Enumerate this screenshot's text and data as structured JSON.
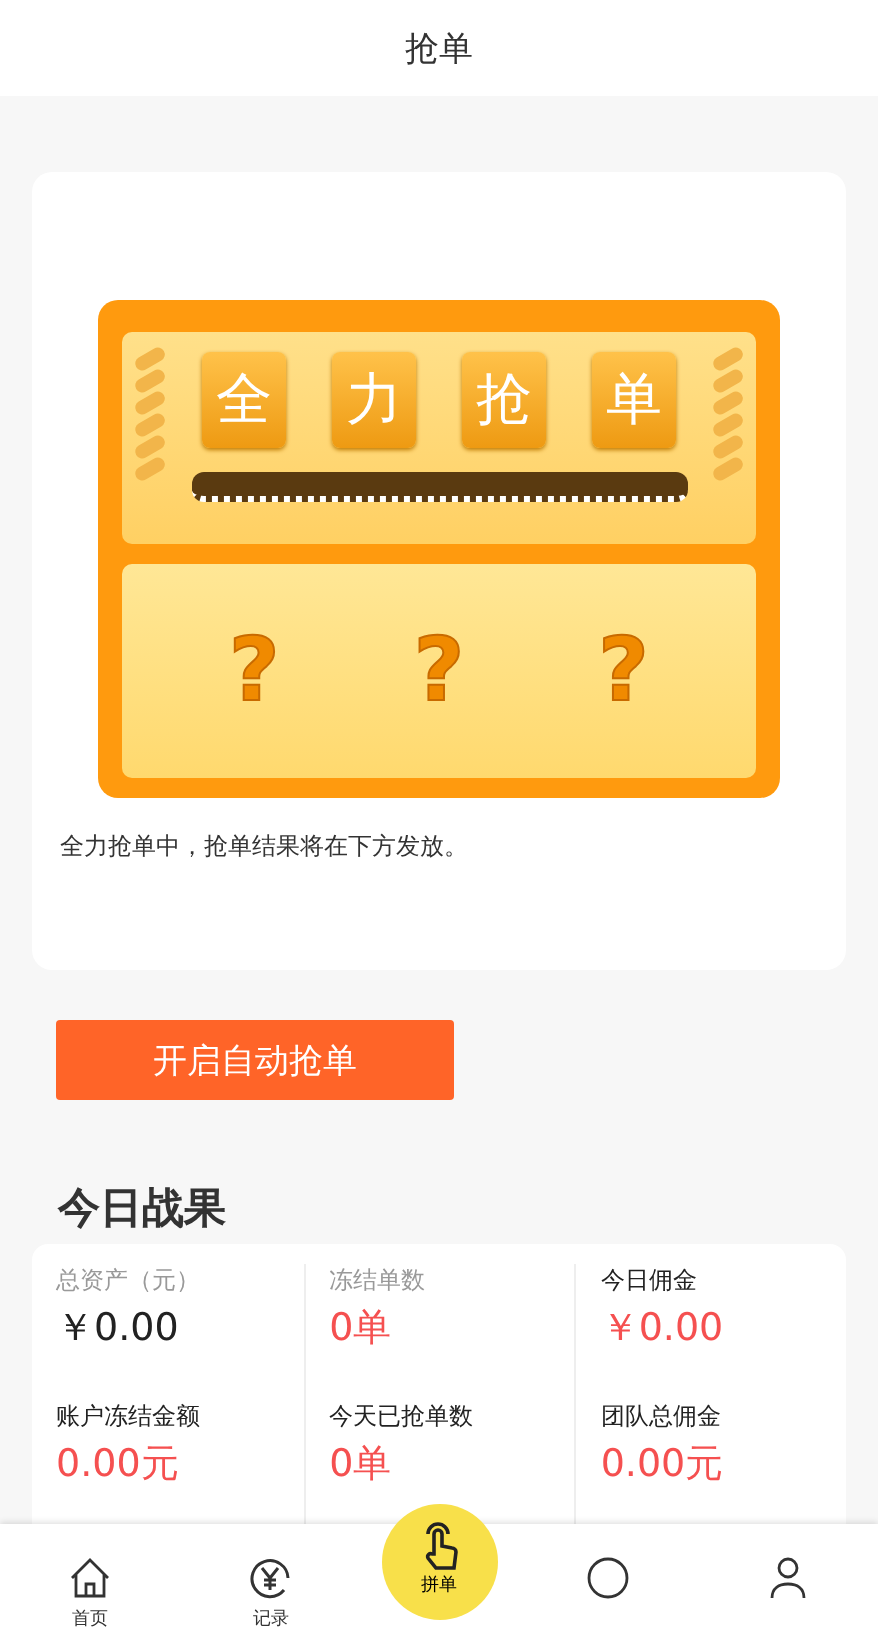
{
  "header": {
    "title": "抢单"
  },
  "machine": {
    "tiles": [
      "全",
      "力",
      "抢",
      "单"
    ],
    "slots": [
      "?",
      "?",
      "?"
    ]
  },
  "status_text": "全力抢单中，抢单结果将在下方发放。",
  "auto_button": {
    "label": "开启自动抢单"
  },
  "section_title": "今日战果",
  "stats": [
    {
      "label": "总资产（元）",
      "value": "￥0.00",
      "label_muted": true,
      "value_accent": false
    },
    {
      "label": "冻结单数",
      "value": "0单",
      "label_muted": true,
      "value_accent": true
    },
    {
      "label": "今日佣金",
      "value": "￥0.00",
      "label_muted": false,
      "value_accent": true
    },
    {
      "label": "账户冻结金额",
      "value": "0.00元",
      "label_muted": false,
      "value_accent": true
    },
    {
      "label": "今天已抢单数",
      "value": "0单",
      "label_muted": false,
      "value_accent": true
    },
    {
      "label": "团队总佣金",
      "value": "0.00元",
      "label_muted": false,
      "value_accent": true
    }
  ],
  "nav": [
    {
      "kind": "home",
      "label": "首页"
    },
    {
      "kind": "record",
      "label": "记录"
    },
    {
      "kind": "center",
      "label": "拼单"
    },
    {
      "kind": "circle"
    },
    {
      "kind": "person"
    }
  ]
}
